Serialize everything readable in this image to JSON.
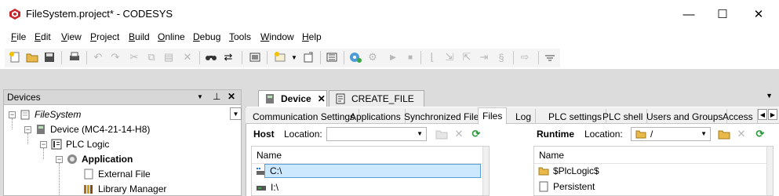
{
  "window": {
    "title": "FileSystem.project* - CODESYS",
    "minimize": "—",
    "maximize": "☐",
    "close": "✕"
  },
  "menu": [
    {
      "label": "File"
    },
    {
      "label": "Edit"
    },
    {
      "label": "View"
    },
    {
      "label": "Project"
    },
    {
      "label": "Build"
    },
    {
      "label": "Online"
    },
    {
      "label": "Debug"
    },
    {
      "label": "Tools"
    },
    {
      "label": "Window"
    },
    {
      "label": "Help"
    }
  ],
  "toolbar": {
    "icons": [
      "new-project-icon",
      "open-project-icon",
      "save-icon",
      "print-icon",
      "undo-icon",
      "redo-icon",
      "cut-icon",
      "copy-icon",
      "paste-icon",
      "delete-icon",
      "find-icon",
      "replace-icon",
      "select-all-icon",
      "build-icon",
      "add-object-icon",
      "breakpoint-icon",
      "login-icon",
      "logout-icon",
      "start-icon",
      "stop-icon",
      "step-over-icon",
      "step-into-icon",
      "step-out-icon",
      "run-to-cursor-icon",
      "set-next-statement-icon",
      "show-current-icon",
      "toolbar-options-icon"
    ]
  },
  "devices": {
    "title": "Devices",
    "pin_glyph": "⊥",
    "close_glyph": "✕",
    "dropdown_glyph": "▼",
    "tree": [
      {
        "label": "FileSystem",
        "italic": true
      },
      {
        "label": "Device (MC4-21-14-H8)"
      },
      {
        "label": "PLC Logic"
      },
      {
        "label": "Application",
        "bold": true
      },
      {
        "label": "External File"
      },
      {
        "label": "Library Manager"
      }
    ]
  },
  "doc_tabs": [
    {
      "label": "Device",
      "active": true,
      "close": "✕"
    },
    {
      "label": "CREATE_FILE",
      "active": false
    }
  ],
  "sub_tabs": [
    {
      "label": "Communication Settings"
    },
    {
      "label": "Applications"
    },
    {
      "label": "Synchronized Files"
    },
    {
      "label": "Files",
      "active": true
    },
    {
      "label": "Log"
    },
    {
      "label": "PLC settings"
    },
    {
      "label": "PLC shell"
    },
    {
      "label": "Users and Groups"
    },
    {
      "label": "Access"
    }
  ],
  "host": {
    "title": "Host",
    "location_label": "Location:",
    "location_value": "",
    "column": "Name",
    "rows": [
      {
        "label": "C:\\",
        "selected": true
      },
      {
        "label": "I:\\"
      }
    ]
  },
  "runtime": {
    "title": "Runtime",
    "location_label": "Location:",
    "location_value": "/",
    "column": "Name",
    "rows": [
      {
        "label": "$PlcLogic$"
      },
      {
        "label": "Persistent"
      }
    ]
  },
  "colors": {
    "selection": "#cce8ff",
    "panel_header": "#d7d7d7",
    "background": "#dcdcdc"
  }
}
